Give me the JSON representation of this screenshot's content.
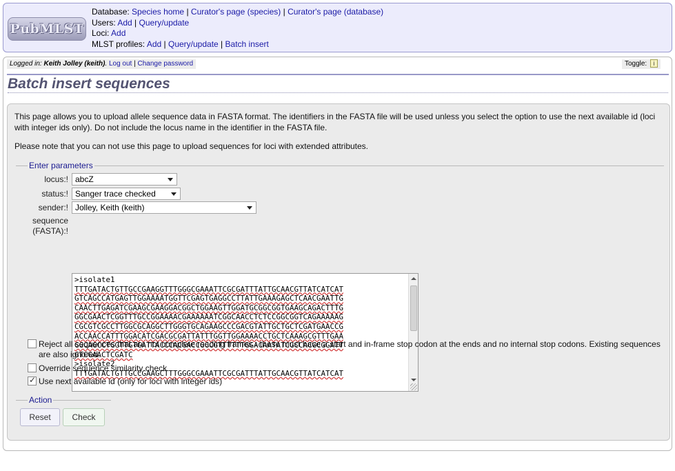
{
  "logo": {
    "text": "PubMLST"
  },
  "dbmenu": {
    "database_label": "Database:",
    "database_links": [
      "Species home",
      "Curator's page (species)",
      "Curator's page (database)"
    ],
    "users_label": "Users:",
    "users_links": [
      "Add",
      "Query/update"
    ],
    "loci_label": "Loci:",
    "loci_links": [
      "Add"
    ],
    "mlst_label": "MLST profiles:",
    "mlst_links": [
      "Add",
      "Query/update",
      "Batch insert"
    ],
    "separator": "|"
  },
  "login": {
    "prefix": "Logged in:",
    "user": "Keith Jolley (keith)",
    "logout": "Log out",
    "change_password": "Change password"
  },
  "toggle": {
    "label": "Toggle:",
    "icon": "i"
  },
  "page_title": "Batch insert sequences",
  "intro_text": "This page allows you to upload allele sequence data in FASTA format. The identifiers in the FASTA file will be used unless you select the option to use the next available id (loci with integer ids only). Do not include the locus name in the identifier in the FASTA file.",
  "note_text": "Please note that you can not use this page to upload sequences for loci with extended attributes.",
  "params": {
    "legend": "Enter parameters",
    "locus_label": "locus:!",
    "locus_value": "abcZ",
    "status_label": "status:!",
    "status_value": "Sanger trace checked",
    "sender_label": "sender:!",
    "sender_value": "Jolley, Keith (keith)",
    "sequence_label_1": "sequence",
    "sequence_label_2": "(FASTA):!",
    "sequence_text": ">isolate1\nTTTGATACTGTTGCCGAAGGTTTGGGCGAAATTCGCGATTTATTGCAACGTTATCATCAT\nGTCAGCCATGAGTTGGAAAATGGTTCGAGTGAGGCCTTATTGAAAGAGCTCAACGAATTG\nCAACTTGAGATCGAAGCGAAGGACGGCTGGAAGTTGGATGCGGCGGTGAAGCAGACTTTG\nGGCGAACTCGGTTTGCCGGAAAACGAAAAAATCGGCAACCTCTCCGGCGGTCAGAAAAAG\nCGCGTCGCCTTGGCGCAGGCTTGGGTGCAGAAGCCCGACGTATTGCTGCTCGATGAACCG\nACCAACCATTTGGACATCGACGCGATTATTTGGTTGGAAAACCTGCTCAAAGCGTTTGAA\nGGCAGCCTGGTTGTGATTACCCACGACCGCCGTTTTTTGGACAATATCGCCACGCGGATT\nGTCGAACTCGATC\n>isolate2\nTTTGATACTGTTGCCGAAGCTTTGGGCGAAATTCGCGATTTATTGCAACGTTATCATCAT",
    "reject_label": "Reject all sequences that are not complete reading frames - these must have a start and in-frame stop codon at the ends and no internal stop codons. Existing sequences are also ignored.",
    "reject_checked": false,
    "override_label": "Override sequence similarity check",
    "override_checked": false,
    "nextid_label": "Use next available id (only for loci with integer ids)",
    "nextid_checked": true
  },
  "action": {
    "legend": "Action",
    "reset_label": "Reset",
    "check_label": "Check"
  }
}
